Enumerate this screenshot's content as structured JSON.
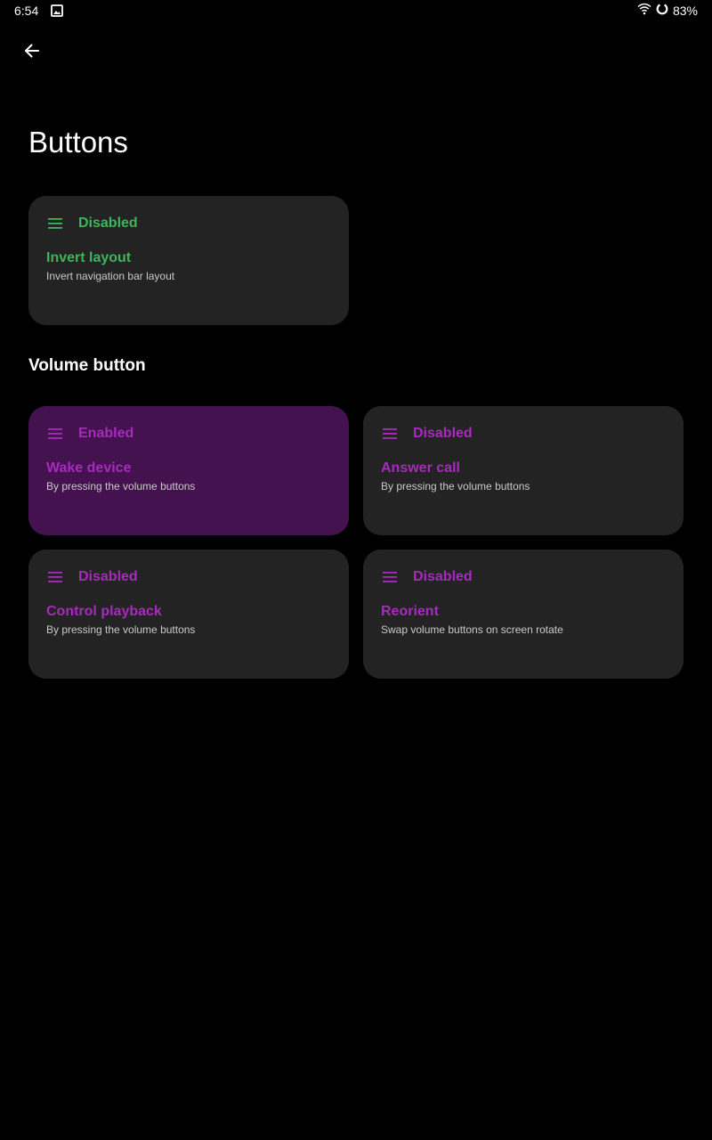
{
  "status_bar": {
    "time": "6:54",
    "battery": "83%",
    "icons": [
      "image-icon",
      "wifi-icon",
      "battery-ring-icon"
    ]
  },
  "header": {
    "back_icon": "arrow-back-icon",
    "title": "Buttons"
  },
  "colors": {
    "background": "#000000",
    "card": "#232323",
    "card_enabled": "#44124f",
    "accent_green": "#3fb45b",
    "accent_purple": "#a62bbd",
    "subtitle": "#c9c9c9"
  },
  "navbar_section": {
    "cards": [
      {
        "status": "Disabled",
        "title": "Invert layout",
        "subtitle": "Invert navigation bar layout",
        "icon": "menu-icon",
        "enabled": false
      }
    ]
  },
  "volume_section": {
    "header": "Volume button",
    "cards": [
      {
        "status": "Enabled",
        "title": "Wake device",
        "subtitle": "By pressing the volume buttons",
        "icon": "menu-icon",
        "enabled": true
      },
      {
        "status": "Disabled",
        "title": "Answer call",
        "subtitle": "By pressing the volume buttons",
        "icon": "menu-icon",
        "enabled": false
      },
      {
        "status": "Disabled",
        "title": "Control playback",
        "subtitle": "By pressing the volume buttons",
        "icon": "menu-icon",
        "enabled": false
      },
      {
        "status": "Disabled",
        "title": "Reorient",
        "subtitle": "Swap volume buttons on screen rotate",
        "icon": "menu-icon",
        "enabled": false
      }
    ]
  }
}
